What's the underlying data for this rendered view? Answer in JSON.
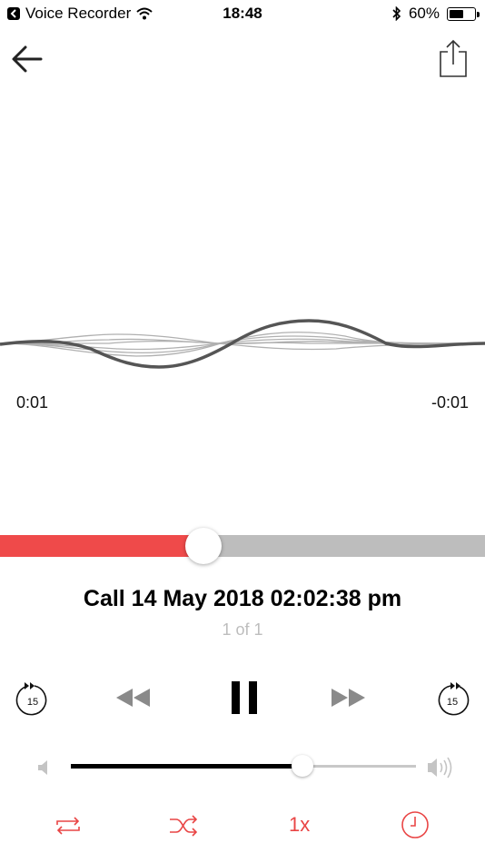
{
  "status_bar": {
    "back_app": "Voice Recorder",
    "time": "18:48",
    "battery": "60%",
    "battery_level": 0.6
  },
  "player": {
    "elapsed": "0:01",
    "remaining": "-0:01",
    "progress": 0.42,
    "title": "Call 14 May 2018 02:02:38 pm",
    "position": "1 of 1",
    "skip_back_seconds": "15",
    "skip_forward_seconds": "15",
    "volume": 0.67,
    "speed": "1x"
  },
  "colors": {
    "accent": "#e94545",
    "progress_fill": "#ef4a4a",
    "track": "#bdbdbd",
    "wave_dark": "#555555",
    "wave_light": "#b0b0b0"
  },
  "icons": [
    "back-arrow-icon",
    "share-icon",
    "skip-back-15-icon",
    "rewind-icon",
    "pause-icon",
    "fast-forward-icon",
    "skip-forward-15-icon",
    "volume-low-icon",
    "volume-high-icon",
    "repeat-icon",
    "shuffle-icon",
    "timer-icon"
  ]
}
